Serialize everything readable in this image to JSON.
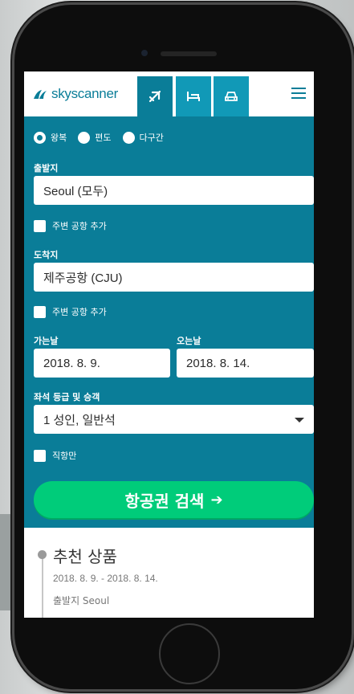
{
  "brand": {
    "name": "skyscanner",
    "color": "#0a7d98",
    "cta_color": "#00cc7a"
  },
  "tabs": [
    {
      "name": "flights",
      "icon": "plane-icon",
      "active": true
    },
    {
      "name": "hotels",
      "icon": "bed-icon",
      "active": false
    },
    {
      "name": "cars",
      "icon": "car-icon",
      "active": false
    }
  ],
  "trip_types": [
    "왕복",
    "편도",
    "다구간"
  ],
  "trip_type_selected": "왕복",
  "origin": {
    "label": "출발지",
    "value": "Seoul (모두)",
    "nearby_label": "주변 공항 추가"
  },
  "destination": {
    "label": "도착지",
    "value": "제주공항 (CJU)",
    "nearby_label": "주변 공항 추가"
  },
  "depart": {
    "label": "가는날",
    "value": "2018. 8. 9."
  },
  "return": {
    "label": "오는날",
    "value": "2018. 8. 14."
  },
  "cabin": {
    "label": "좌석 등급 및 승객",
    "value": "1 성인, 일반석"
  },
  "direct_only_label": "직항만",
  "search_button": {
    "label": "항공권 검색",
    "icon": "arrow-right-icon"
  },
  "recommendations": {
    "title": "추천 상품",
    "dates": "2018. 8. 9. - 2018. 8. 14.",
    "origin": "출발지 Seoul"
  }
}
